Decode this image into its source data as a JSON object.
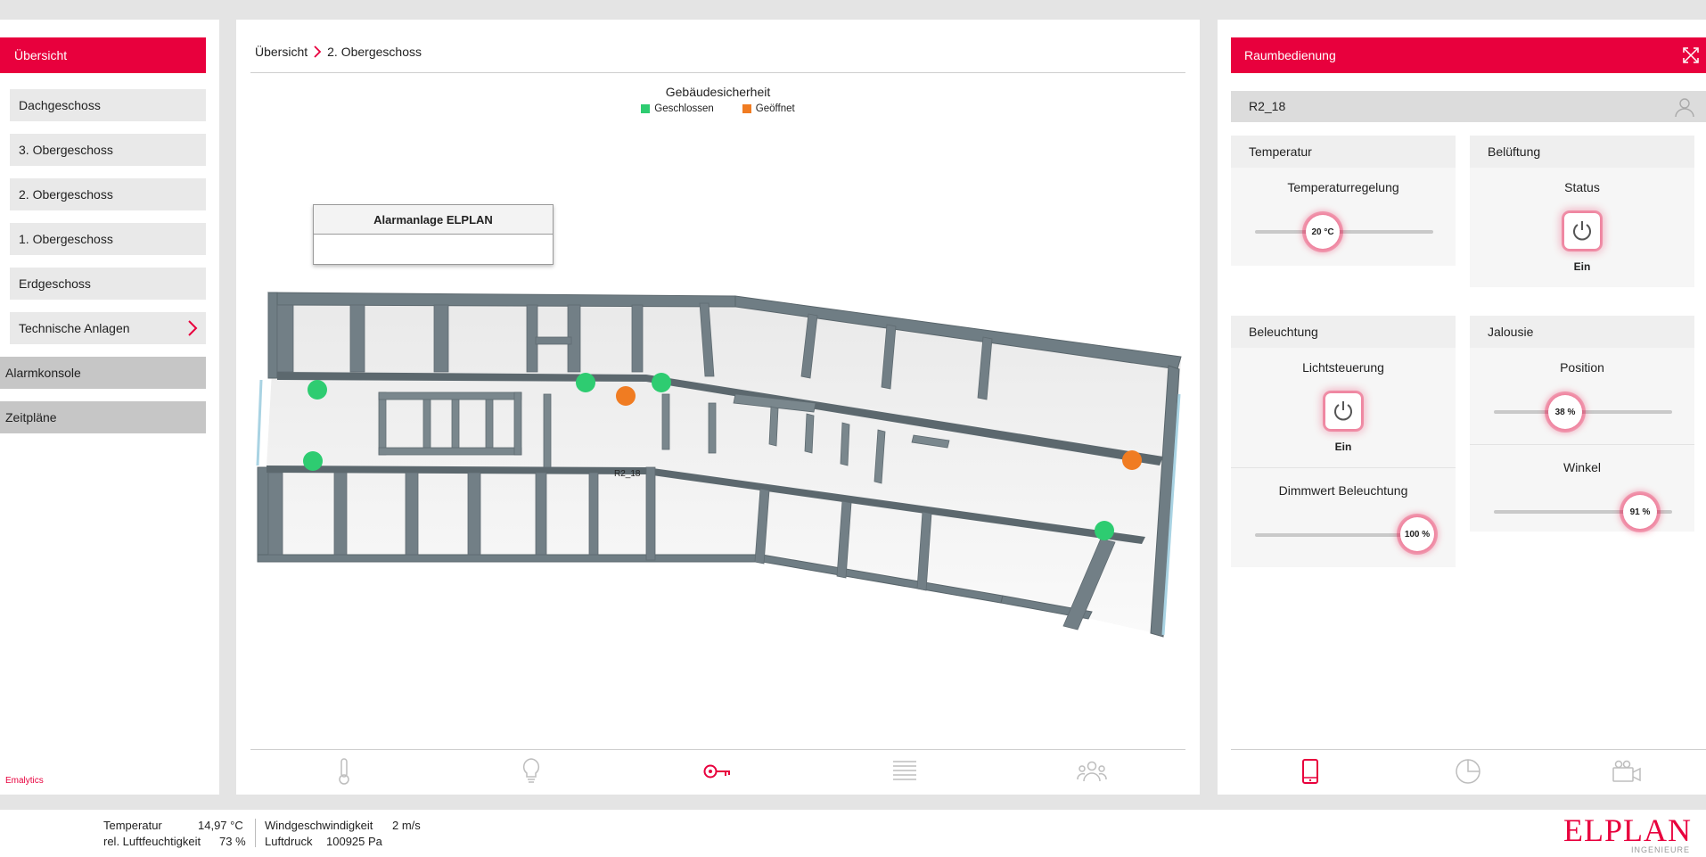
{
  "sidebar": {
    "active_label": "Übersicht",
    "floors": [
      "Dachgeschoss",
      "3. Obergeschoss",
      "2. Obergeschoss",
      "1. Obergeschoss",
      "Erdgeschoss",
      "Technische Anlagen"
    ],
    "sections": [
      "Alarmkonsole",
      "Zeitpläne"
    ],
    "brand": "Emalytics"
  },
  "center": {
    "breadcrumb": [
      "Übersicht",
      "2. Obergeschoss"
    ],
    "legend_title": "Gebäudesicherheit",
    "legend": [
      {
        "label": "Geschlossen",
        "color": "#2ecc71"
      },
      {
        "label": "Geöffnet",
        "color": "#f07c22"
      }
    ],
    "alarm_box_title": "Alarmanlage ELPLAN",
    "room_label": "R2_18",
    "bottom_icons": [
      "thermometer-icon",
      "lightbulb-icon",
      "key-icon",
      "blinds-icon",
      "people-icon"
    ],
    "active_icon": "key-icon"
  },
  "right": {
    "header": "Raumbedienung",
    "room": "R2_18",
    "temperatur": {
      "title": "Temperatur",
      "label": "Temperaturregelung",
      "value": "20 °C",
      "fraction": 0.37
    },
    "belueftung": {
      "title": "Belüftung",
      "label": "Status",
      "state": "Ein"
    },
    "beleuchtung": {
      "title": "Beleuchtung",
      "label": "Lichtsteuerung",
      "state": "Ein",
      "dimm_label": "Dimmwert Beleuchtung",
      "dimm_value": "100 %",
      "dimm_fraction": 1.0
    },
    "jalousie": {
      "title": "Jalousie",
      "pos_label": "Position",
      "pos_value": "38 %",
      "pos_fraction": 0.38,
      "win_label": "Winkel",
      "win_value": "91 %",
      "win_fraction": 0.91
    },
    "bottom_icons": [
      "mobile-icon",
      "pie-chart-icon",
      "camera-icon"
    ],
    "active_icon": "mobile-icon"
  },
  "footer": {
    "temp_label": "Temperatur",
    "temp_value": "14,97 °C",
    "hum_label": "rel. Luftfeuchtigkeit",
    "hum_value": "73 %",
    "wind_label": "Windgeschwindigkeit",
    "wind_value": "2 m/s",
    "press_label": "Luftdruck",
    "press_value": "100925 Pa",
    "logo_main": "ELPLAN",
    "logo_sub": "INGENIEURE"
  },
  "colors": {
    "accent": "#e8003d",
    "closed": "#2ecc71",
    "open": "#f07c22",
    "wall": "#6f7d84"
  }
}
